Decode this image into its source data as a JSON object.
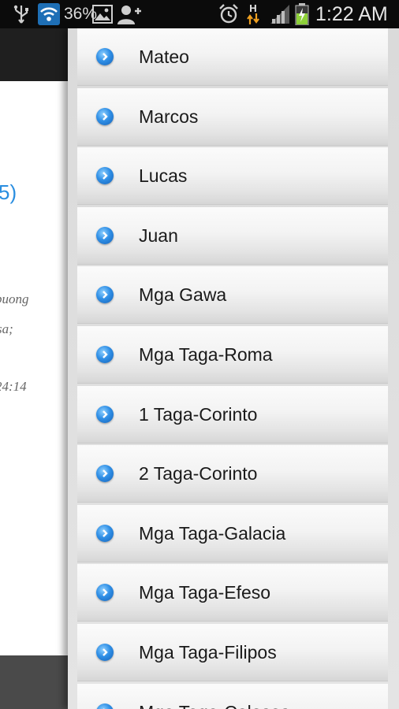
{
  "status_bar": {
    "battery_percent": "36%",
    "network_type": "H",
    "time": "1:22 AM",
    "icons": [
      "usb-icon",
      "wifi-icon",
      "picture-icon",
      "add-contact-icon",
      "alarm-icon",
      "data-arrows-icon",
      "signal-icon",
      "battery-charging-icon"
    ]
  },
  "background_page": {
    "heading_fragment": "5)",
    "verse_lines": [
      "buong",
      "sa;",
      "24:14"
    ]
  },
  "drawer": {
    "books": [
      {
        "label": "Mateo"
      },
      {
        "label": "Marcos"
      },
      {
        "label": "Lucas"
      },
      {
        "label": "Juan"
      },
      {
        "label": "Mga Gawa"
      },
      {
        "label": "Mga Taga-Roma"
      },
      {
        "label": "1 Taga-Corinto"
      },
      {
        "label": "2 Taga-Corinto"
      },
      {
        "label": "Mga Taga-Galacia"
      },
      {
        "label": "Mga Taga-Efeso"
      },
      {
        "label": "Mga Taga-Filipos"
      },
      {
        "label": "Mga Taga-Colosas"
      }
    ]
  },
  "colors": {
    "accent_blue": "#2a8ee0",
    "status_bar_bg": "#0b0b0b",
    "battery_green": "#8fd23a"
  }
}
